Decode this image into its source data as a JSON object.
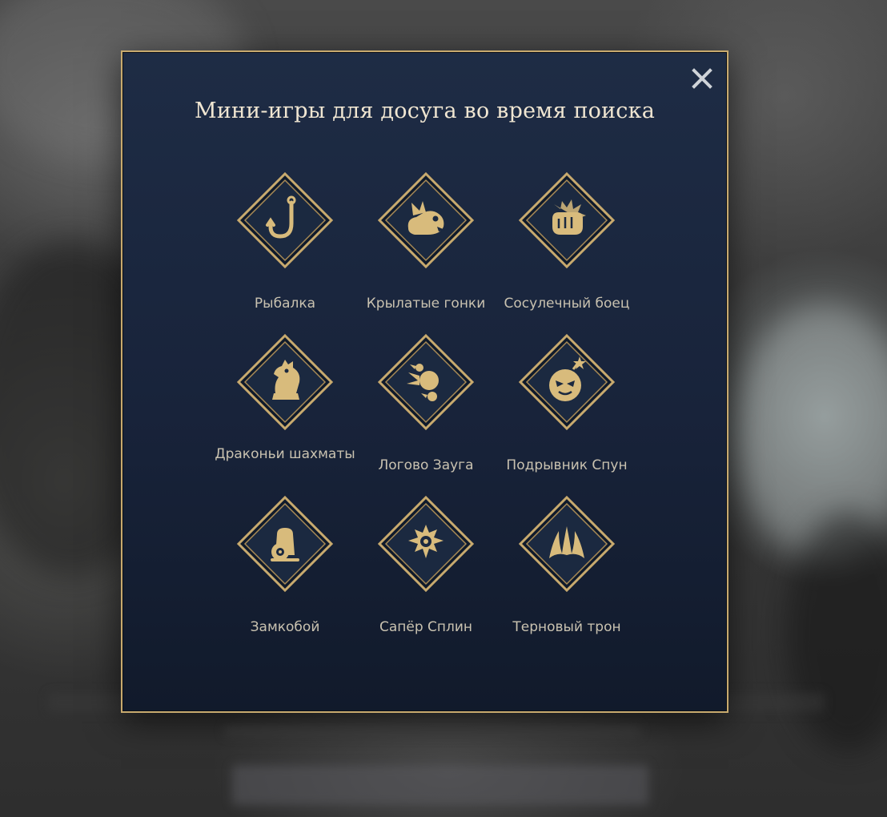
{
  "dialog": {
    "title": "Мини-игры для досуга во время поиска",
    "close_icon": "close-icon"
  },
  "games": [
    {
      "label": "Рыбалка",
      "icon": "fishing-hook-icon"
    },
    {
      "label": "Крылатые гонки",
      "icon": "winged-creature-icon"
    },
    {
      "label": "Сосулечный боец",
      "icon": "icicle-fist-icon"
    },
    {
      "label": "Драконьи шахматы",
      "icon": "dragon-chess-knight-icon"
    },
    {
      "label": "Логово Зауга",
      "icon": "flaming-orbs-icon"
    },
    {
      "label": "Подрывник Спун",
      "icon": "bomb-face-icon"
    },
    {
      "label": "Замкобой",
      "icon": "cannon-icon"
    },
    {
      "label": "Сапёр Сплин",
      "icon": "spiked-mine-icon"
    },
    {
      "label": "Терновый трон",
      "icon": "thorn-throne-icon"
    }
  ],
  "colors": {
    "panel": "#18233a",
    "border_gold": "#c8aa6e",
    "icon_gold": "#d8bb7c",
    "title": "#f0e6d2",
    "label": "#c9c2b0"
  }
}
